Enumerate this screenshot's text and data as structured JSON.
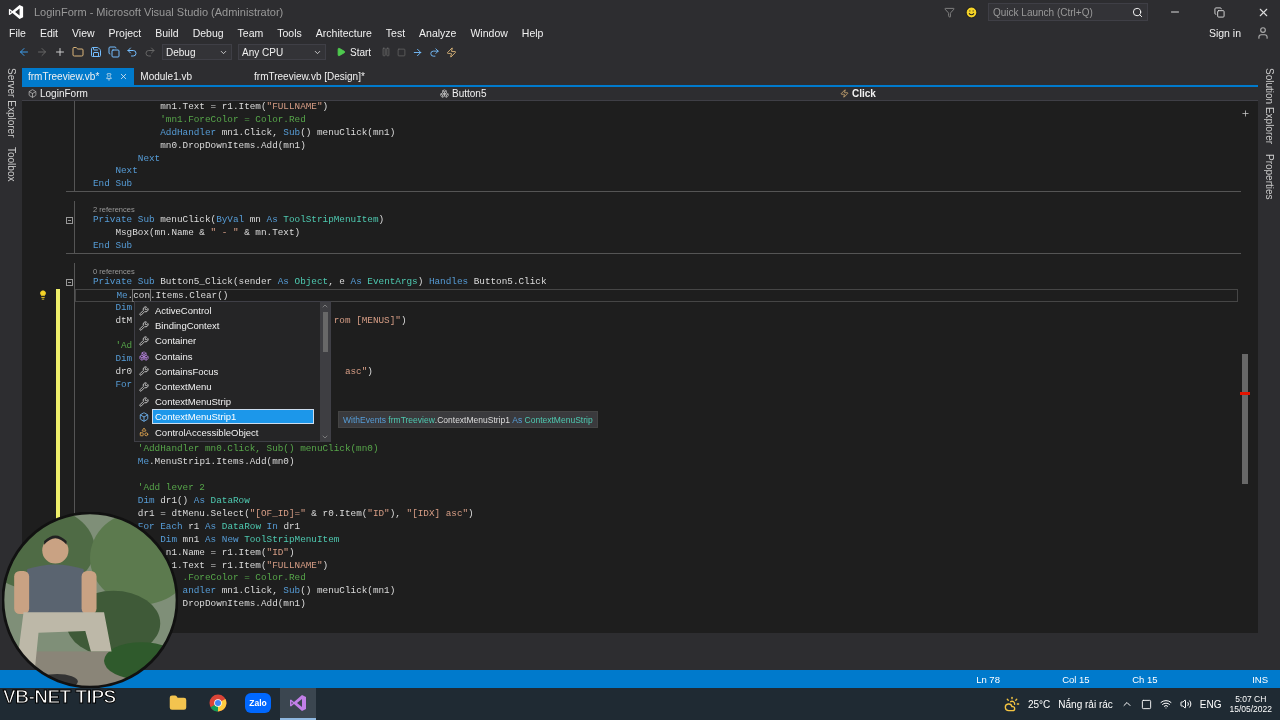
{
  "title_bar": {
    "title": "LoginForm - Microsoft Visual Studio (Administrator)",
    "quick_launch": {
      "placeholder": "Quick Launch (Ctrl+Q)"
    }
  },
  "menu_bar": {
    "items": [
      "File",
      "Edit",
      "View",
      "Project",
      "Build",
      "Debug",
      "Team",
      "Tools",
      "Architecture",
      "Test",
      "Analyze",
      "Window",
      "Help"
    ],
    "sign_in": "Sign in"
  },
  "toolbar": {
    "configuration": "Debug",
    "platform": "Any CPU",
    "start": "Start"
  },
  "side_tabs_left": [
    "Server Explorer",
    "Toolbox"
  ],
  "side_tabs_right": [
    "Solution Explorer",
    "Properties"
  ],
  "tabs": [
    {
      "label": "frmTreeview.vb*",
      "selected": true
    },
    {
      "label": "Module1.vb",
      "selected": false
    },
    {
      "label": "frmTreeview.vb [Design]*",
      "selected": false
    }
  ],
  "nav_bar": {
    "project": "LoginForm",
    "object": "Button5",
    "event": "Click"
  },
  "editor": {
    "lines": [
      {
        "kind": "code",
        "modified": false,
        "tokens": [
          {
            "kind": "plain",
            "text": "            mn1.Text = r1.Item("
          },
          {
            "kind": "string",
            "text": "\"FULLNAME\""
          },
          {
            "kind": "plain",
            "text": ")"
          }
        ]
      },
      {
        "kind": "code",
        "modified": false,
        "tokens": [
          {
            "kind": "comment",
            "text": "            'mn1.ForeColor = Color.Red"
          }
        ]
      },
      {
        "kind": "code",
        "modified": false,
        "tokens": [
          {
            "kind": "keyword",
            "text": "            AddHandler"
          },
          {
            "kind": "plain",
            "text": " mn1.Click, "
          },
          {
            "kind": "keyword",
            "text": "Sub"
          },
          {
            "kind": "plain",
            "text": "() menuClick(mn1)"
          }
        ]
      },
      {
        "kind": "code",
        "modified": false,
        "tokens": [
          {
            "kind": "plain",
            "text": "            mn0.DropDownItems.Add(mn1)"
          }
        ]
      },
      {
        "kind": "code",
        "modified": false,
        "tokens": [
          {
            "kind": "keyword",
            "text": "        Next"
          }
        ]
      },
      {
        "kind": "code",
        "modified": false,
        "tokens": [
          {
            "kind": "keyword",
            "text": "    Next"
          }
        ]
      },
      {
        "kind": "code",
        "modified": false,
        "tokens": [
          {
            "kind": "keyword",
            "text": "End Sub"
          }
        ]
      },
      {
        "kind": "divider"
      },
      {
        "kind": "lens",
        "text": "2 references"
      },
      {
        "kind": "header",
        "modified": false,
        "tokens": [
          {
            "kind": "keyword",
            "text": "Private Sub"
          },
          {
            "kind": "plain",
            "text": " menuClick("
          },
          {
            "kind": "keyword",
            "text": "ByVal"
          },
          {
            "kind": "plain",
            "text": " mn "
          },
          {
            "kind": "keyword",
            "text": "As"
          },
          {
            "kind": "type",
            "text": " ToolStripMenuItem"
          },
          {
            "kind": "plain",
            "text": ")"
          }
        ]
      },
      {
        "kind": "code",
        "modified": false,
        "tokens": [
          {
            "kind": "plain",
            "text": "    MsgBox(mn.Name & "
          },
          {
            "kind": "string",
            "text": "\" - \""
          },
          {
            "kind": "plain",
            "text": " & mn.Text)"
          }
        ]
      },
      {
        "kind": "code",
        "modified": false,
        "tokens": [
          {
            "kind": "keyword",
            "text": "End Sub"
          }
        ]
      },
      {
        "kind": "divider"
      },
      {
        "kind": "lens",
        "text": "0 references"
      },
      {
        "kind": "header",
        "modified": false,
        "tokens": [
          {
            "kind": "keyword",
            "text": "Private Sub"
          },
          {
            "kind": "plain",
            "text": " Button5_Click(sender "
          },
          {
            "kind": "keyword",
            "text": "As"
          },
          {
            "kind": "type",
            "text": " Object"
          },
          {
            "kind": "plain",
            "text": ", e "
          },
          {
            "kind": "keyword",
            "text": "As"
          },
          {
            "kind": "type",
            "text": " EventArgs"
          },
          {
            "kind": "plain",
            "text": ") "
          },
          {
            "kind": "keyword",
            "text": "Handles"
          },
          {
            "kind": "plain",
            "text": " Button5.Click"
          }
        ]
      },
      {
        "kind": "active",
        "modified": true,
        "tokens": [
          {
            "kind": "keyword",
            "text": "    Me"
          },
          {
            "kind": "plain",
            "text": "."
          },
          {
            "kind": "match",
            "text": "con"
          },
          {
            "kind": "plain",
            "text": ".Items.Clear()"
          }
        ]
      },
      {
        "kind": "code",
        "modified": true,
        "tokens": [
          {
            "kind": "keyword",
            "text": "    Dim"
          }
        ]
      },
      {
        "kind": "code",
        "modified": true,
        "segments": [
          {
            "tokens": [
              {
                "kind": "plain",
                "text": "    dtM"
              }
            ]
          },
          {
            "tokens": [
              {
                "kind": "string",
                "text": "                                    rom [MENUS]\""
              },
              {
                "kind": "plain",
                "text": ")"
              }
            ]
          }
        ]
      },
      {
        "kind": "blank",
        "modified": true
      },
      {
        "kind": "code",
        "modified": true,
        "tokens": [
          {
            "kind": "comment",
            "text": "    'Ad"
          }
        ]
      },
      {
        "kind": "code",
        "modified": true,
        "tokens": [
          {
            "kind": "keyword",
            "text": "    Dim"
          }
        ]
      },
      {
        "kind": "code",
        "modified": true,
        "segments": [
          {
            "tokens": [
              {
                "kind": "plain",
                "text": "    dr0"
              }
            ]
          },
          {
            "tokens": [
              {
                "kind": "string",
                "text": "                                      asc\""
              },
              {
                "kind": "plain",
                "text": ")"
              }
            ]
          }
        ]
      },
      {
        "kind": "code",
        "modified": true,
        "tokens": [
          {
            "kind": "keyword",
            "text": "    For"
          }
        ]
      },
      {
        "kind": "blank",
        "modified": true
      },
      {
        "kind": "blank",
        "modified": true
      },
      {
        "kind": "blank",
        "modified": true
      },
      {
        "kind": "blank",
        "modified": true
      },
      {
        "kind": "code",
        "modified": true,
        "tokens": [
          {
            "kind": "comment",
            "text": "        'AddHandler mn0.Click, Sub() menuClick(mn0)"
          }
        ]
      },
      {
        "kind": "code",
        "modified": true,
        "tokens": [
          {
            "kind": "keyword",
            "text": "        Me"
          },
          {
            "kind": "plain",
            "text": ".MenuStrip1.Items.Add(mn0)"
          }
        ]
      },
      {
        "kind": "blank",
        "modified": true
      },
      {
        "kind": "code",
        "modified": true,
        "tokens": [
          {
            "kind": "comment",
            "text": "        'Add lever 2"
          }
        ]
      },
      {
        "kind": "code",
        "modified": true,
        "tokens": [
          {
            "kind": "keyword",
            "text": "        Dim"
          },
          {
            "kind": "plain",
            "text": " dr1() "
          },
          {
            "kind": "keyword",
            "text": "As"
          },
          {
            "kind": "type",
            "text": " DataRow"
          }
        ]
      },
      {
        "kind": "code",
        "modified": true,
        "tokens": [
          {
            "kind": "plain",
            "text": "        dr1 = dtMenu.Select("
          },
          {
            "kind": "string",
            "text": "\"[OF_ID]=\""
          },
          {
            "kind": "plain",
            "text": " & r0.Item("
          },
          {
            "kind": "string",
            "text": "\"ID\""
          },
          {
            "kind": "plain",
            "text": "), "
          },
          {
            "kind": "string",
            "text": "\"[IDX] asc\""
          },
          {
            "kind": "plain",
            "text": ")"
          }
        ]
      },
      {
        "kind": "code",
        "tokens": [
          {
            "kind": "keyword",
            "text": "        For Each"
          },
          {
            "kind": "plain",
            "text": " r1 "
          },
          {
            "kind": "keyword",
            "text": "As"
          },
          {
            "kind": "type",
            "text": " DataRow"
          },
          {
            "kind": "keyword",
            "text": " In"
          },
          {
            "kind": "plain",
            "text": " dr1"
          }
        ]
      },
      {
        "kind": "code",
        "tokens": [
          {
            "kind": "keyword",
            "text": "            Dim"
          },
          {
            "kind": "plain",
            "text": " mn1 "
          },
          {
            "kind": "keyword",
            "text": "As New"
          },
          {
            "kind": "type",
            "text": " ToolStripMenuItem"
          }
        ]
      },
      {
        "kind": "code",
        "tokens": [
          {
            "kind": "plain",
            "text": "             n1.Name = r1.Item("
          },
          {
            "kind": "string",
            "text": "\"ID\""
          },
          {
            "kind": "plain",
            "text": ")"
          }
        ]
      },
      {
        "kind": "code",
        "tokens": [
          {
            "kind": "plain",
            "text": "              1.Text = r1.Item("
          },
          {
            "kind": "string",
            "text": "\"FULLNAME\""
          },
          {
            "kind": "plain",
            "text": ")"
          }
        ]
      },
      {
        "kind": "code",
        "tokens": [
          {
            "kind": "comment",
            "text": "                .ForeColor = Color.Red"
          }
        ]
      },
      {
        "kind": "code",
        "tokens": [
          {
            "kind": "keyword",
            "text": "                andler"
          },
          {
            "kind": "plain",
            "text": " mn1.Click, "
          },
          {
            "kind": "keyword",
            "text": "Sub"
          },
          {
            "kind": "plain",
            "text": "() menuClick(mn1)"
          }
        ]
      },
      {
        "kind": "code",
        "tokens": [
          {
            "kind": "plain",
            "text": "                DropDownItems.Add(mn1)"
          }
        ]
      }
    ]
  },
  "completion": {
    "items": [
      {
        "label": "ActiveControl",
        "kind": "property",
        "selected": false
      },
      {
        "label": "BindingContext",
        "kind": "property",
        "selected": false
      },
      {
        "label": "Container",
        "kind": "property",
        "selected": false
      },
      {
        "label": "Contains",
        "kind": "method",
        "selected": false
      },
      {
        "label": "ContainsFocus",
        "kind": "property",
        "selected": false
      },
      {
        "label": "ContextMenu",
        "kind": "property",
        "selected": false
      },
      {
        "label": "ContextMenuStrip",
        "kind": "property",
        "selected": false
      },
      {
        "label": "ContextMenuStrip1",
        "kind": "field",
        "selected": true
      },
      {
        "label": "ControlAccessibleObject",
        "kind": "class",
        "selected": false
      }
    ],
    "tooltip": [
      {
        "kind": "keyword",
        "text": "WithEvents"
      },
      {
        "kind": "type",
        "text": " frmTreeview"
      },
      {
        "kind": "plain",
        "text": ".ContextMenuStrip1 "
      },
      {
        "kind": "keyword",
        "text": "As"
      },
      {
        "kind": "type",
        "text": " ContextMenuStrip"
      }
    ]
  },
  "status_bar": {
    "line": "Ln 78",
    "column": "Col 15",
    "char": "Ch 15",
    "mode": "INS"
  },
  "overlay": {
    "caption": "VB-NET TIPS"
  },
  "taskbar": {
    "apps": [
      {
        "kind": "explorer",
        "selected": false
      },
      {
        "kind": "chrome",
        "selected": false
      },
      {
        "kind": "zalo",
        "label": "Zalo",
        "selected": false
      },
      {
        "kind": "vs",
        "selected": true
      }
    ],
    "weather": {
      "temperature": "25°C",
      "summary": "Nắng rải rác"
    },
    "language": "ENG",
    "time": "5:07 CH",
    "date": "15/05/2022"
  }
}
